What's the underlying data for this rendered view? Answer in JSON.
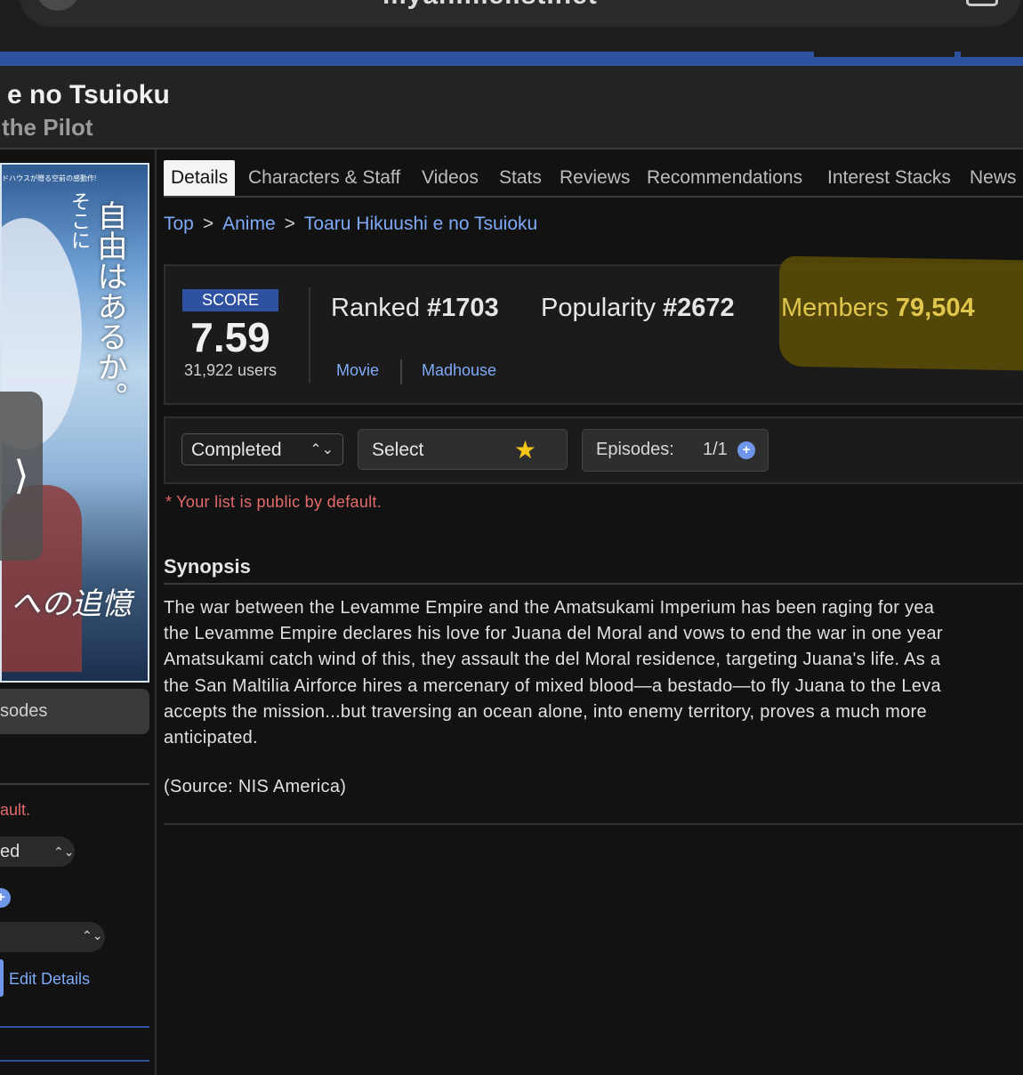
{
  "browser": {
    "url": "myanimelist.net"
  },
  "anime": {
    "title_partial": "e no Tsuioku",
    "english_partial": "the Pilot"
  },
  "poster": {
    "top_text": "ドハウスが贈る空前の感動作!",
    "vertical_text": "自由はあるか。",
    "vertical_text2": "そこに",
    "bottom_text": "への追憶"
  },
  "left": {
    "next_glyph": "⟩",
    "episodes_label": "sodes",
    "public_note": "ault.",
    "status_partial": "ed",
    "chevron": "⌃⌄",
    "plus": "+",
    "edit_details": "Edit Details"
  },
  "tabs": [
    {
      "label": "Details"
    },
    {
      "label": "Characters & Staff"
    },
    {
      "label": "Videos"
    },
    {
      "label": "Stats"
    },
    {
      "label": "Reviews"
    },
    {
      "label": "Recommendations"
    },
    {
      "label": "Interest Stacks"
    },
    {
      "label": "News"
    }
  ],
  "breadcrumb": {
    "top": "Top",
    "anime": "Anime",
    "current": "Toaru Hikuushi e no Tsuioku",
    "separator": ">"
  },
  "stats": {
    "score_label": "SCORE",
    "score": "7.59",
    "users": "31,922 users",
    "ranked_label": "Ranked",
    "ranked_value": "#1703",
    "popularity_label": "Popularity",
    "popularity_value": "#2672",
    "members_label": "Members",
    "members_value": "79,504",
    "type": "Movie",
    "studio": "Madhouse"
  },
  "list": {
    "status": "Completed",
    "rating_placeholder": "Select",
    "episodes_label": "Episodes:",
    "episodes_value": "1/1",
    "public_note": "* Your list is public by default."
  },
  "synopsis": {
    "title": "Synopsis",
    "lines": [
      "The war between the Levamme Empire and the Amatsukami Imperium has been raging for yea",
      "the Levamme Empire declares his love for Juana del Moral and vows to end the war in one year",
      "Amatsukami catch wind of this, they assault the del Moral residence, targeting Juana's life. As a",
      "the San Maltilia Airforce hires a mercenary of mixed blood—a bestado—to fly Juana to the Leva",
      "accepts the mission...but traversing an ocean alone, into enemy territory, proves a much more",
      "anticipated."
    ],
    "source": "(Source: NIS America)"
  },
  "colors": {
    "accent_blue": "#2e51a2",
    "link_blue": "#7eaaf7",
    "warning_red": "#e36b6b",
    "members_yellow": "#e0c64b",
    "highlight": "#5c4d06"
  }
}
